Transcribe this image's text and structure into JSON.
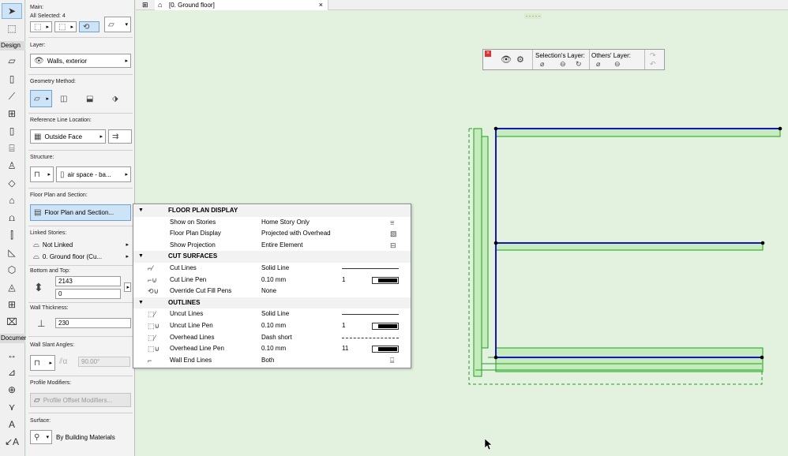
{
  "toolbox": {
    "design_label": "Design",
    "document_label": "Documer",
    "tools": [
      "arrow-tool",
      "marquee-tool",
      "wall-tool",
      "column-tool",
      "beam-tool",
      "window-tool",
      "door-tool",
      "object-tool",
      "stair-tool",
      "slab-tool",
      "roof-tool",
      "shell-tool",
      "curtain-wall-tool",
      "mesh-tool",
      "morph-tool",
      "zone-tool",
      "railing-tool",
      "dimension-tool",
      "level-dim-tool",
      "radial-dim-tool",
      "angle-dim-tool",
      "text-tool",
      "label-tool"
    ]
  },
  "info": {
    "main_label": "Main:",
    "all_selected": "All Selected: 4",
    "layer_label": "Layer:",
    "layer_value": "Walls, exterior",
    "geometry_label": "Geometry Method:",
    "refline_label": "Reference Line Location:",
    "refline_value": "Outside Face",
    "structure_label": "Structure:",
    "structure_value": "air space - ba...",
    "fps_label": "Floor Plan and Section:",
    "fps_value": "Floor Plan and Section...",
    "linked_label": "Linked Stories:",
    "linked_top": "Not Linked",
    "linked_bottom": "0. Ground floor (Cu...",
    "bottom_top_label": "Bottom and Top:",
    "top_value": "2143",
    "bottom_value": "0",
    "thickness_label": "Wall Thickness:",
    "thickness_value": "230",
    "slant_label": "Wall Slant Angles:",
    "slant_value": "90.00°",
    "profile_label": "Profile Modifiers:",
    "profile_value": "Profile Offset Modifiers...",
    "surface_label": "Surface:",
    "surface_value": "By Building Materials"
  },
  "tab": {
    "title": "[0. Ground floor]",
    "close": "×"
  },
  "palette": {
    "selection_layer": "Selection's Layer:",
    "others_layer": "Others' Layer:"
  },
  "popup": {
    "sections": [
      {
        "title": "FLOOR PLAN DISPLAY",
        "rows": [
          {
            "name": "Show on Stories",
            "value": "Home Story Only"
          },
          {
            "name": "Floor Plan Display",
            "value": "Projected with Overhead"
          },
          {
            "name": "Show Projection",
            "value": "Entire Element"
          }
        ]
      },
      {
        "title": "CUT SURFACES",
        "rows": [
          {
            "name": "Cut Lines",
            "value": "Solid Line"
          },
          {
            "name": "Cut Line Pen",
            "value": "0.10 mm",
            "num": "1"
          },
          {
            "name": "Override Cut Fill Pens",
            "value": "None"
          }
        ]
      },
      {
        "title": "OUTLINES",
        "rows": [
          {
            "name": "Uncut Lines",
            "value": "Solid Line"
          },
          {
            "name": "Uncut Line Pen",
            "value": "0.10 mm",
            "num": "1"
          },
          {
            "name": "Overhead Lines",
            "value": "Dash short"
          },
          {
            "name": "Overhead Line Pen",
            "value": "0.10 mm",
            "num": "11"
          },
          {
            "name": "Wall End Lines",
            "value": "Both"
          }
        ]
      }
    ]
  },
  "colors": {
    "canvas_bg": "#e3f1df",
    "wall_fill": "#c6ecbd",
    "wall_outline": "#19a319",
    "ref_line": "#1414d0",
    "accent": "#cde4f7"
  }
}
